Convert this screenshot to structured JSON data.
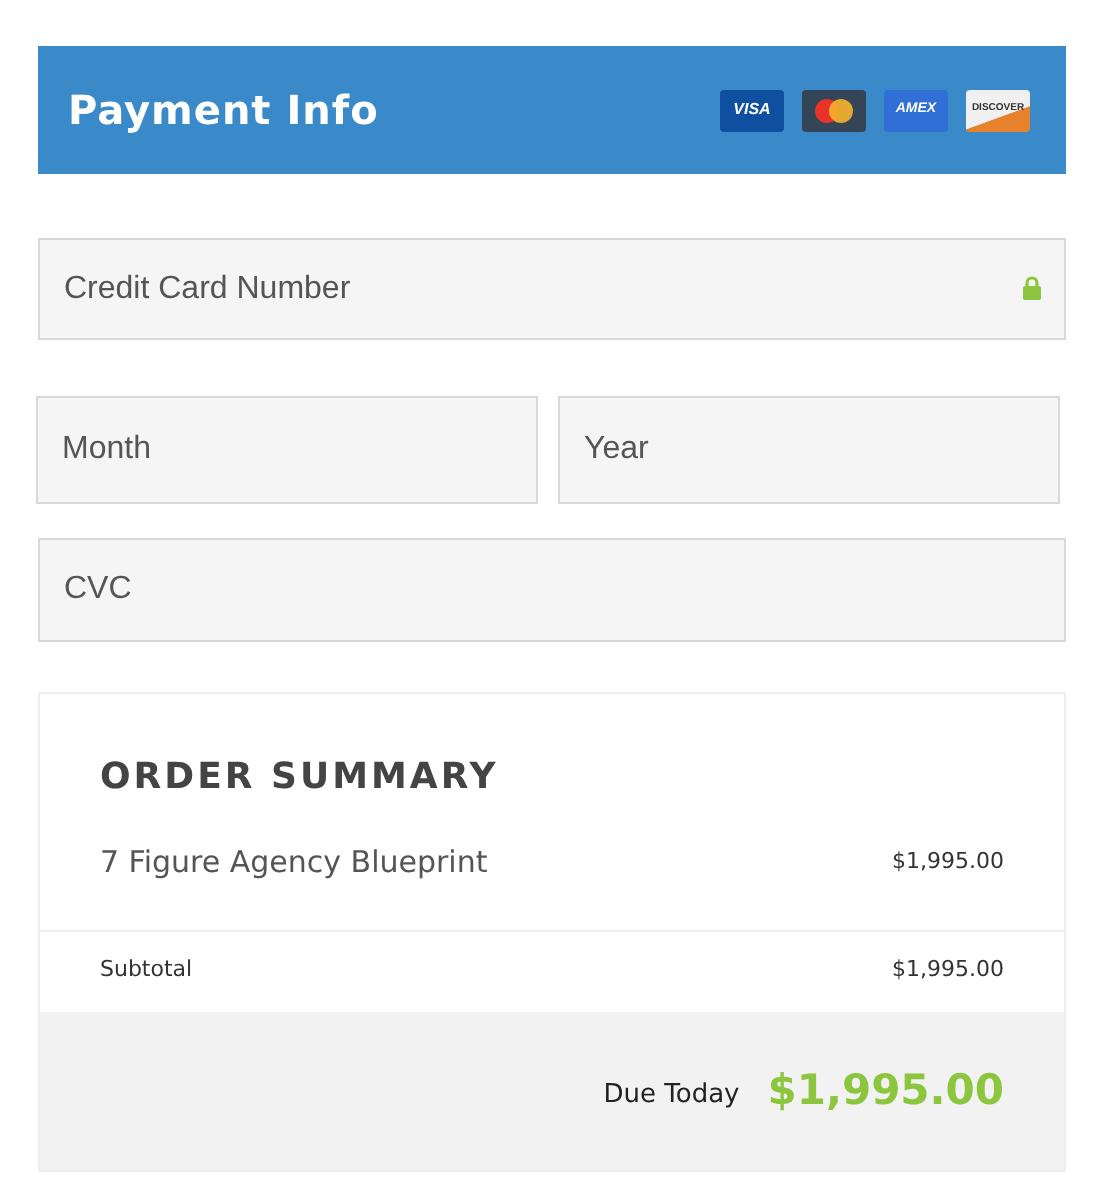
{
  "header": {
    "title": "Payment Info",
    "cards": [
      {
        "kind": "visa",
        "label": "VISA"
      },
      {
        "kind": "mastercard"
      },
      {
        "kind": "amex",
        "label": "AMEX"
      },
      {
        "kind": "discover",
        "label": "DISCOVER"
      }
    ]
  },
  "card_number": {
    "placeholder": "Credit Card Number",
    "secure": true
  },
  "month": {
    "placeholder": "Month"
  },
  "year": {
    "placeholder": "Year"
  },
  "cvc": {
    "placeholder": "CVC"
  },
  "summary": {
    "title": "ORDER SUMMARY",
    "items": [
      {
        "name": "7 Figure Agency Blueprint",
        "price": "$1,995.00"
      }
    ],
    "subtotal_label": "Subtotal",
    "subtotal": "$1,995.00",
    "due_label": "Due Today",
    "due": "$1,995.00"
  }
}
